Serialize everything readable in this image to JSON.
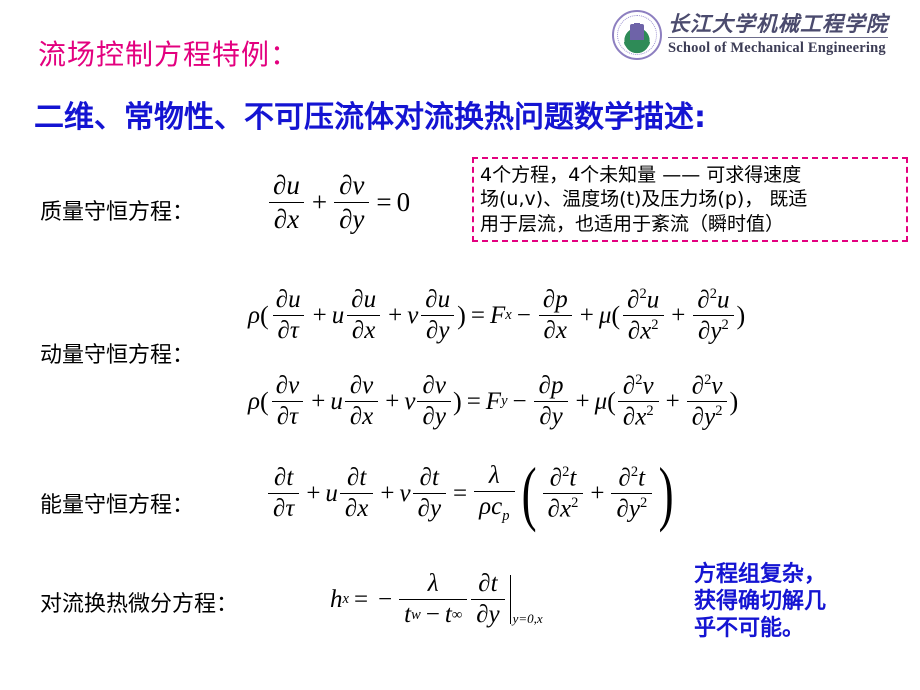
{
  "header": {
    "logo_icon": "university-seal-icon",
    "institution_cn": "长江大学机械工程学院",
    "institution_en": "School of Mechanical Engineering"
  },
  "titles": {
    "line1": "流场控制方程特例：",
    "line1_color": "#e3007f",
    "line2": "二维、常物性、不可压流体对流换热问题数学描述:",
    "line2_color": "#1414d2"
  },
  "labels": {
    "mass": "质量守恒方程：",
    "momentum": "动量守恒方程：",
    "energy": "能量守恒方程：",
    "convection": "对流换热微分方程："
  },
  "note_box": {
    "border_color": "#e3007f",
    "lines": [
      "4个方程，4个未知量 —— 可求得速度",
      "场(u,v)、温度场(t)及压力场(p)， 既适",
      "用于层流，也适用于紊流（瞬时值）"
    ]
  },
  "blue_note": {
    "color": "#1414d2",
    "lines": [
      "方程组复杂，",
      "获得确切解几",
      "乎不可能。"
    ]
  },
  "equations": {
    "mass": {
      "name": "continuity-equation",
      "latex": "\\partial u/\\partial x + \\partial v/\\partial y = 0",
      "parts": {
        "num1": "∂u",
        "den1": "∂x",
        "op1": "+",
        "num2": "∂v",
        "den2": "∂y",
        "eq": "=",
        "rhs": "0"
      }
    },
    "momentum_x": {
      "name": "x-momentum-equation",
      "latex": "\\rho(\\partial u/\\partial \\tau + u \\partial u/\\partial x + v \\partial u/\\partial y) = F_x - \\partial p/\\partial x + \\mu(\\partial^2 u/\\partial x^2 + \\partial^2 u/\\partial y^2)",
      "parts": {
        "rho": "ρ",
        "lp": "(",
        "n1": "∂u",
        "d1": "∂τ",
        "p1": "+",
        "c1": "u",
        "n2": "∂u",
        "d2": "∂x",
        "p2": "+",
        "c2": "v",
        "n3": "∂u",
        "d3": "∂y",
        "rp": ")",
        "eq": "=",
        "force": "F",
        "force_sub": "x",
        "minus": "−",
        "n4": "∂p",
        "d4": "∂x",
        "plus": "+",
        "mu": "μ",
        "lp2": "(",
        "n5": "∂",
        "n5sup": "2",
        "n5var": "u",
        "d5": "∂x",
        "d5sup": "2",
        "p3": "+",
        "n6": "∂",
        "n6sup": "2",
        "n6var": "u",
        "d6": "∂y",
        "d6sup": "2",
        "rp2": ")"
      }
    },
    "momentum_y": {
      "name": "y-momentum-equation",
      "latex": "\\rho(\\partial v/\\partial \\tau + u \\partial v/\\partial x + v \\partial v/\\partial y) = F_y - \\partial p/\\partial y + \\mu(\\partial^2 v/\\partial x^2 + \\partial^2 v/\\partial y^2)",
      "parts": {
        "rho": "ρ",
        "lp": "(",
        "n1": "∂v",
        "d1": "∂τ",
        "p1": "+",
        "c1": "u",
        "n2": "∂v",
        "d2": "∂x",
        "p2": "+",
        "c2": "v",
        "n3": "∂v",
        "d3": "∂y",
        "rp": ")",
        "eq": "=",
        "force": "F",
        "force_sub": "y",
        "minus": "−",
        "n4": "∂p",
        "d4": "∂y",
        "plus": "+",
        "mu": "μ",
        "lp2": "(",
        "n5": "∂",
        "n5sup": "2",
        "n5var": "v",
        "d5": "∂x",
        "d5sup": "2",
        "p3": "+",
        "n6": "∂",
        "n6sup": "2",
        "n6var": "v",
        "d6": "∂y",
        "d6sup": "2",
        "rp2": ")"
      }
    },
    "energy": {
      "name": "energy-equation",
      "latex": "\\partial t/\\partial \\tau + u \\partial t/\\partial x + v \\partial t/\\partial y = \\lambda/(\\rho c_p)(\\partial^2 t/\\partial x^2 + \\partial^2 t/\\partial y^2)",
      "parts": {
        "n1": "∂t",
        "d1": "∂τ",
        "p1": "+",
        "c1": "u",
        "n2": "∂t",
        "d2": "∂x",
        "p2": "+",
        "c2": "v",
        "n3": "∂t",
        "d3": "∂y",
        "eq": "=",
        "lam": "λ",
        "rhocp": "ρc",
        "cp_sub": "p",
        "lp": "(",
        "n4": "∂",
        "n4sup": "2",
        "n4var": "t",
        "d4": "∂x",
        "d4sup": "2",
        "p3": "+",
        "n5": "∂",
        "n5sup": "2",
        "n5var": "t",
        "d5": "∂y",
        "d5sup": "2",
        "rp": ")"
      }
    },
    "convection": {
      "name": "convective-heat-transfer-equation",
      "latex": "h_x = -\\frac{\\lambda}{t_w - t_\\infty}\\frac{\\partial t}{\\partial y}\\Big|_{y=0,x}",
      "parts": {
        "h": "h",
        "h_sub": "x",
        "eq": "=",
        "minus": "−",
        "num": "λ",
        "den_tw": "t",
        "den_tw_sub": "w",
        "den_minus": "−",
        "den_tinf": "t",
        "den_tinf_sub": "∞",
        "n2": "∂t",
        "d2": "∂y",
        "eval": "y=0,x"
      }
    }
  }
}
